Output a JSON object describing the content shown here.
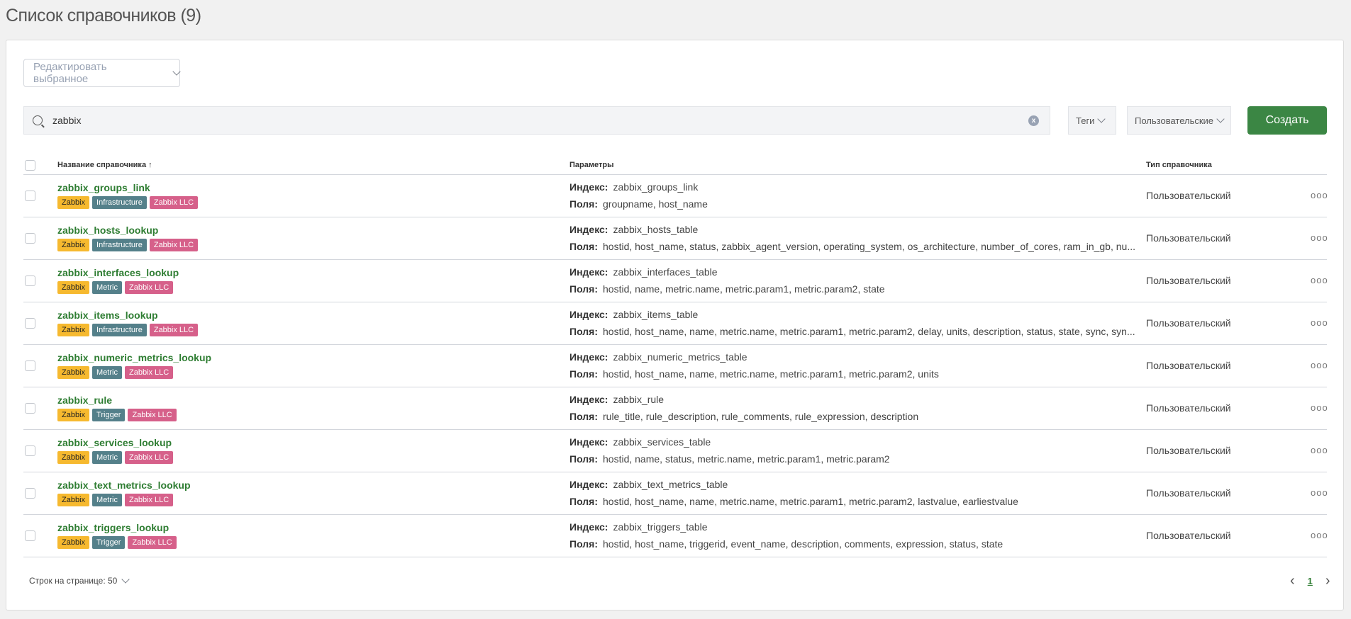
{
  "page_title": "Список справочников (9)",
  "edit_selected": "Редактировать выбранное",
  "search": {
    "value": "zabbix",
    "clear": "x"
  },
  "filters": {
    "tags": "Теги",
    "type": "Пользовательские"
  },
  "create_button": "Создать",
  "columns": {
    "name": "Название справочника",
    "params": "Параметры",
    "type": "Тип справочника"
  },
  "labels": {
    "index": "Индекс:",
    "fields": "Поля:"
  },
  "colors": {
    "Zabbix": "#f6b92f",
    "Infrastructure": "#54808a",
    "Metric": "#54808a",
    "Trigger": "#54808a",
    "Zabbix LLC": "#d6608a"
  },
  "rows": [
    {
      "name": "zabbix_groups_link",
      "tags": [
        "Zabbix",
        "Infrastructure",
        "Zabbix LLC"
      ],
      "index": "zabbix_groups_link",
      "fields": "groupname, host_name",
      "type": "Пользовательский"
    },
    {
      "name": "zabbix_hosts_lookup",
      "tags": [
        "Zabbix",
        "Infrastructure",
        "Zabbix LLC"
      ],
      "index": "zabbix_hosts_table",
      "fields": "hostid, host_name, status, zabbix_agent_version, operating_system, os_architecture, number_of_cores, ram_in_gb, nu...",
      "type": "Пользовательский"
    },
    {
      "name": "zabbix_interfaces_lookup",
      "tags": [
        "Zabbix",
        "Metric",
        "Zabbix LLC"
      ],
      "index": "zabbix_interfaces_table",
      "fields": "hostid, name, metric.name, metric.param1, metric.param2, state",
      "type": "Пользовательский"
    },
    {
      "name": "zabbix_items_lookup",
      "tags": [
        "Zabbix",
        "Infrastructure",
        "Zabbix LLC"
      ],
      "index": "zabbix_items_table",
      "fields": "hostid, host_name, name, metric.name, metric.param1, metric.param2, delay, units, description, status, state, sync, syn...",
      "type": "Пользовательский"
    },
    {
      "name": "zabbix_numeric_metrics_lookup",
      "tags": [
        "Zabbix",
        "Metric",
        "Zabbix LLC"
      ],
      "index": "zabbix_numeric_metrics_table",
      "fields": "hostid, host_name, name, metric.name, metric.param1, metric.param2, units",
      "type": "Пользовательский"
    },
    {
      "name": "zabbix_rule",
      "tags": [
        "Zabbix",
        "Trigger",
        "Zabbix LLC"
      ],
      "index": "zabbix_rule",
      "fields": "rule_title, rule_description, rule_comments, rule_expression, description",
      "type": "Пользовательский"
    },
    {
      "name": "zabbix_services_lookup",
      "tags": [
        "Zabbix",
        "Metric",
        "Zabbix LLC"
      ],
      "index": "zabbix_services_table",
      "fields": "hostid, name, status, metric.name, metric.param1, metric.param2",
      "type": "Пользовательский"
    },
    {
      "name": "zabbix_text_metrics_lookup",
      "tags": [
        "Zabbix",
        "Metric",
        "Zabbix LLC"
      ],
      "index": "zabbix_text_metrics_table",
      "fields": "hostid, host_name, name, metric.name, metric.param1, metric.param2, lastvalue, earliestvalue",
      "type": "Пользовательский"
    },
    {
      "name": "zabbix_triggers_lookup",
      "tags": [
        "Zabbix",
        "Trigger",
        "Zabbix LLC"
      ],
      "index": "zabbix_triggers_table",
      "fields": "hostid, host_name, triggerid, event_name, description, comments, expression, status, state",
      "type": "Пользовательский"
    }
  ],
  "footer": {
    "rows_per_page": "Строк на странице: 50",
    "page": "1",
    "prev": "‹",
    "next": "›"
  },
  "row_menu": "ooo"
}
